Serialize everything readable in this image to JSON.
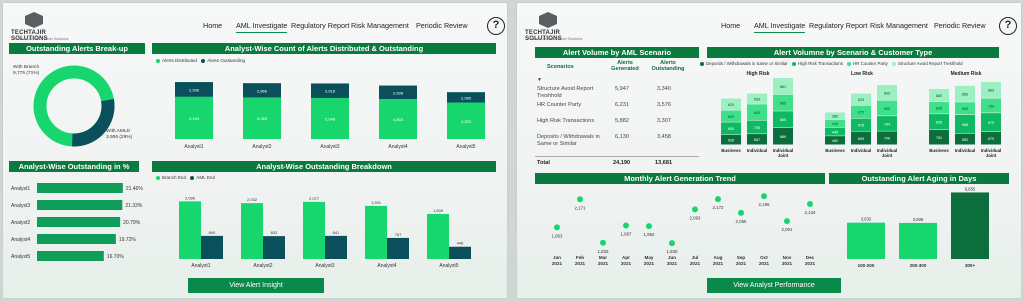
{
  "colors": {
    "dark": "#0b4f5c",
    "green": "#17d66e",
    "mid": "#0f9e5a",
    "deep": "#0b6e3c",
    "header": "#0b7a3e"
  },
  "left": {
    "logo": {
      "name": "TECHTAJIR SOLUTIONS",
      "tagline": "Professional Tech Partner Solutions"
    },
    "nav": [
      "Home",
      "AML Investigate",
      "Regulatory Report",
      "Risk Management",
      "Periodic Review"
    ],
    "active_nav": "AML Investigate",
    "help": "?",
    "donut": {
      "title": "Outstanding Alerts Break-up",
      "branch_label": "With Branch",
      "branch_value": "9,775 (71%)",
      "amld_label": "With AMLD",
      "amld_value": "3,906 (29%)"
    },
    "dist": {
      "title": "Analyst-Wise Count of Alerts Distributed & Outstanding",
      "legend": [
        "Alerts Distributed",
        "Alerts Outstanding"
      ]
    },
    "pct": {
      "title": "Analyst-Wise Outstanding in %"
    },
    "breakdown": {
      "title": "Analyst-Wise Outstanding Breakdown",
      "legend": [
        "Branch End",
        "AML End"
      ]
    },
    "button": "View Alert Insight"
  },
  "right": {
    "logo": {
      "name": "TECHTAJIR SOLUTIONS",
      "tagline": "Professional Tech Partner Solutions"
    },
    "nav": [
      "Home",
      "AML Investigate",
      "Regulatory Report",
      "Risk Management",
      "Periodic Review"
    ],
    "active_nav": "AML Investigate",
    "help": "?",
    "table": {
      "title": "Alert Volume by AML Scenario",
      "headers": [
        "Scenarios",
        "Alerts Generated",
        "Alerts Outstanding"
      ],
      "rows": [
        {
          "name": "Structure Avoid Report Treshhold",
          "gen": "5,947",
          "out": "3,340"
        },
        {
          "name": "HR Counter Party",
          "gen": "6,231",
          "out": "3,576"
        },
        {
          "name": "High Risk Transactions",
          "gen": "5,882",
          "out": "3,307"
        },
        {
          "name": "Deposits / Withdrawals in Same or Similar",
          "gen": "6,130",
          "out": "3,458"
        }
      ],
      "total": {
        "name": "Total",
        "gen": "24,190",
        "out": "13,681"
      }
    },
    "scenario": {
      "title": "Alert Volumne by Scenario & Customer Type",
      "legend": [
        "Deposits / Withdrawals in Same or Similar",
        "High Risk Transactions",
        "HR Counter Party",
        "Structure Avoid Report Treshhold"
      ],
      "groups": [
        "High Risk",
        "Low Risk",
        "Medium Risk"
      ],
      "customer_types": [
        "Business",
        "Individual",
        "Individual Joint"
      ]
    },
    "trend": {
      "title": "Monthly Alert Generation Trend"
    },
    "aging": {
      "title": "Outstanding Alert Aging in Days"
    },
    "button": "View Analyst Performance"
  },
  "chart_data": [
    {
      "type": "pie",
      "title": "Outstanding Alerts Break-up",
      "labels": [
        "With Branch",
        "With AMLD"
      ],
      "values": [
        9775,
        3906
      ]
    },
    {
      "type": "bar",
      "title": "Analyst-Wise Count of Alerts Distributed & Outstanding",
      "categories": [
        "Analyst1",
        "Analyst2",
        "Analyst3",
        "Analyst4",
        "Analyst5"
      ],
      "series": [
        {
          "name": "Alerts Distributed",
          "values": [
            5169,
            5069,
            5048,
            4853,
            4253
          ]
        },
        {
          "name": "Alerts Outstanding",
          "values": [
            2936,
            2866,
            2918,
            2698,
            2085
          ]
        }
      ]
    },
    {
      "type": "bar",
      "title": "Analyst-Wise Outstanding in %",
      "categories": [
        "Analyst1",
        "Analyst3",
        "Analyst2",
        "Analyst4",
        "Analyst5"
      ],
      "values": [
        21.46,
        21.33,
        20.79,
        19.72,
        16.7
      ]
    },
    {
      "type": "bar",
      "title": "Analyst-Wise Outstanding Breakdown",
      "categories": [
        "Analyst1",
        "Analyst2",
        "Analyst3",
        "Analyst4",
        "Analyst5"
      ],
      "series": [
        {
          "name": "Branch End",
          "values": [
            2096,
            2032,
            2077,
            1931,
            1639
          ]
        },
        {
          "name": "AML End",
          "values": [
            840,
            832,
            841,
            767,
            446
          ]
        }
      ]
    },
    {
      "type": "bar",
      "title": "Alert Volumne by Scenario & Customer Type",
      "groups": [
        {
          "name": "High Risk",
          "categories": [
            "Business",
            "Individual",
            "Individual Joint"
          ],
          "series": [
            [
              528,
              567,
              889
            ],
            [
              650,
              705,
              865
            ],
            [
              620,
              843,
              865
            ],
            [
              620,
              563,
              861
            ]
          ]
        },
        {
          "name": "Low Risk",
          "categories": [
            "Business",
            "Individual",
            "Individual Joint"
          ],
          "series": [
            [
              460,
              699,
              708
            ],
            [
              445,
              678,
              794
            ],
            [
              406,
              675,
              809
            ],
            [
              380,
              623,
              809
            ]
          ]
        },
        {
          "name": "Medium Risk",
          "categories": [
            "Business",
            "Individual",
            "Individual Joint"
          ],
          "series": [
            [
              781,
              592,
              679
            ],
            [
              826,
              968,
              979
            ],
            [
              628,
              663,
              759
            ],
            [
              680,
              856,
              863
            ]
          ]
        }
      ]
    },
    {
      "type": "scatter",
      "title": "Monthly Alert Generation Trend",
      "x": [
        "Jan 2021",
        "Feb 2021",
        "Mar 2021",
        "Apr 2021",
        "May 2021",
        "Jun 2021",
        "Jul 2021",
        "Aug 2021",
        "Sep 2021",
        "Oct 2021",
        "Nov 2021",
        "Dec 2021"
      ],
      "y": [
        1953,
        2171,
        1833,
        1967,
        1962,
        1830,
        2093,
        2172,
        2065,
        2196,
        2001,
        2134
      ]
    },
    {
      "type": "bar",
      "title": "Outstanding Alert Aging in Days",
      "categories": [
        "100-200",
        "200-300",
        "300+"
      ],
      "values": [
        3632,
        3606,
        6655
      ]
    }
  ]
}
